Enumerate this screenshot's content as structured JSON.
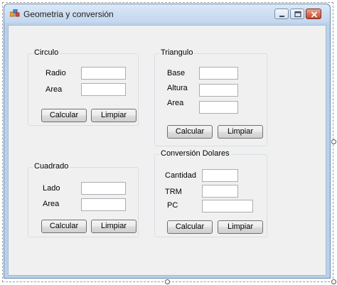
{
  "window": {
    "title": "Geometria y conversión",
    "app_icon": "form-icon",
    "controls": [
      "minimize-icon",
      "maximize-icon",
      "close-icon"
    ]
  },
  "circulo": {
    "title": "Circulo",
    "radio_label": "Radio",
    "area_label": "Area",
    "radio_value": "",
    "area_value": "",
    "calcular": "Calcular",
    "limpiar": "Limpiar"
  },
  "triangulo": {
    "title": "Triangulo",
    "base_label": "Base",
    "altura_label": "Altura",
    "area_label": "Area",
    "base_value": "",
    "altura_value": "",
    "area_value": "",
    "calcular": "Calcular",
    "limpiar": "Limpiar"
  },
  "cuadrado": {
    "title": "Cuadrado",
    "lado_label": "Lado",
    "area_label": "Area",
    "lado_value": "",
    "area_value": "",
    "calcular": "Calcular",
    "limpiar": "Limpiar"
  },
  "conversion": {
    "title": "Conversión Dolares",
    "cantidad_label": "Cantidad",
    "trm_label": "TRM",
    "pc_label": "PC",
    "cantidad_value": "",
    "trm_value": "",
    "pc_value": "",
    "calcular": "Calcular",
    "limpiar": "Limpiar"
  }
}
